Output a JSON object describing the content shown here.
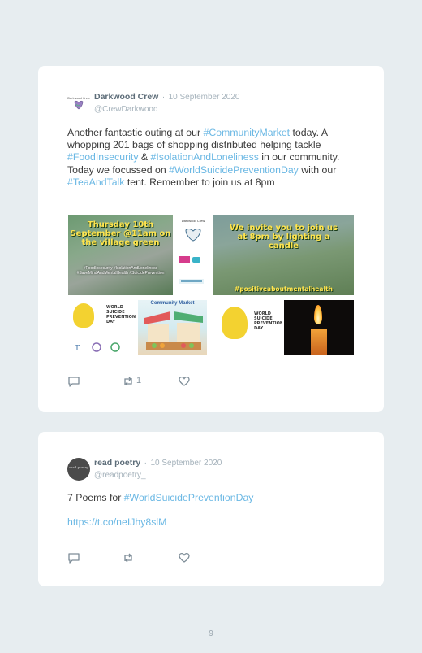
{
  "post1": {
    "author": "Darkwood Crew",
    "dot": "·",
    "date": "10 September 2020",
    "handle": "@CrewDarkwood",
    "text": {
      "p1": "Another fantastic outing at our ",
      "tag1": "#CommunityMarket",
      "p2": " today. A whopping 201 bags of shopping distributed helping tackle ",
      "tag2": "#FoodInsecurity",
      "p3": " & ",
      "tag3": "#IsolationAndLoneliness",
      "p4": " in our community. Today we focussed on ",
      "tag4": "#WorldSuicidePreventionDay",
      "p5": " with our ",
      "tag5": "#TeaAndTalk",
      "p6": " tent. Remember to join us at 8pm"
    },
    "images": {
      "img1_title": "Thursday 10th September @11am on the village green",
      "img1_tags": "#FoodInsecurity #IsolationAndLoneliness #SaveMindAndMentalHealth #SuicidePrevention",
      "img3_title": "We invite you to join us at 8pm by lighting a candle",
      "img3_tag": "#positiveaboutmentalhealth",
      "img4_text": "WORLD SUICIDE PREVENTION DAY",
      "img5_title": "Community Market",
      "img6_text": "WORLD SUICIDE PREVENTION DAY"
    },
    "retweet_count": "1"
  },
  "post2": {
    "author": "read poetry",
    "dot": "·",
    "date": "10 September 2020",
    "handle": "@readpoetry_",
    "avatar_text": "read poetry",
    "text": {
      "p1": "7 Poems for ",
      "tag1": "#WorldSuicidePreventionDay"
    },
    "link": "https://t.co/neIJhy8slM"
  },
  "page_number": "9",
  "colors": {
    "background": "#e7edf0",
    "card": "#ffffff",
    "hashtag": "#6bb8e4",
    "meta": "#a5b2bb",
    "author": "#5d6d79"
  },
  "icons": [
    "reply-icon",
    "retweet-icon",
    "like-icon"
  ]
}
